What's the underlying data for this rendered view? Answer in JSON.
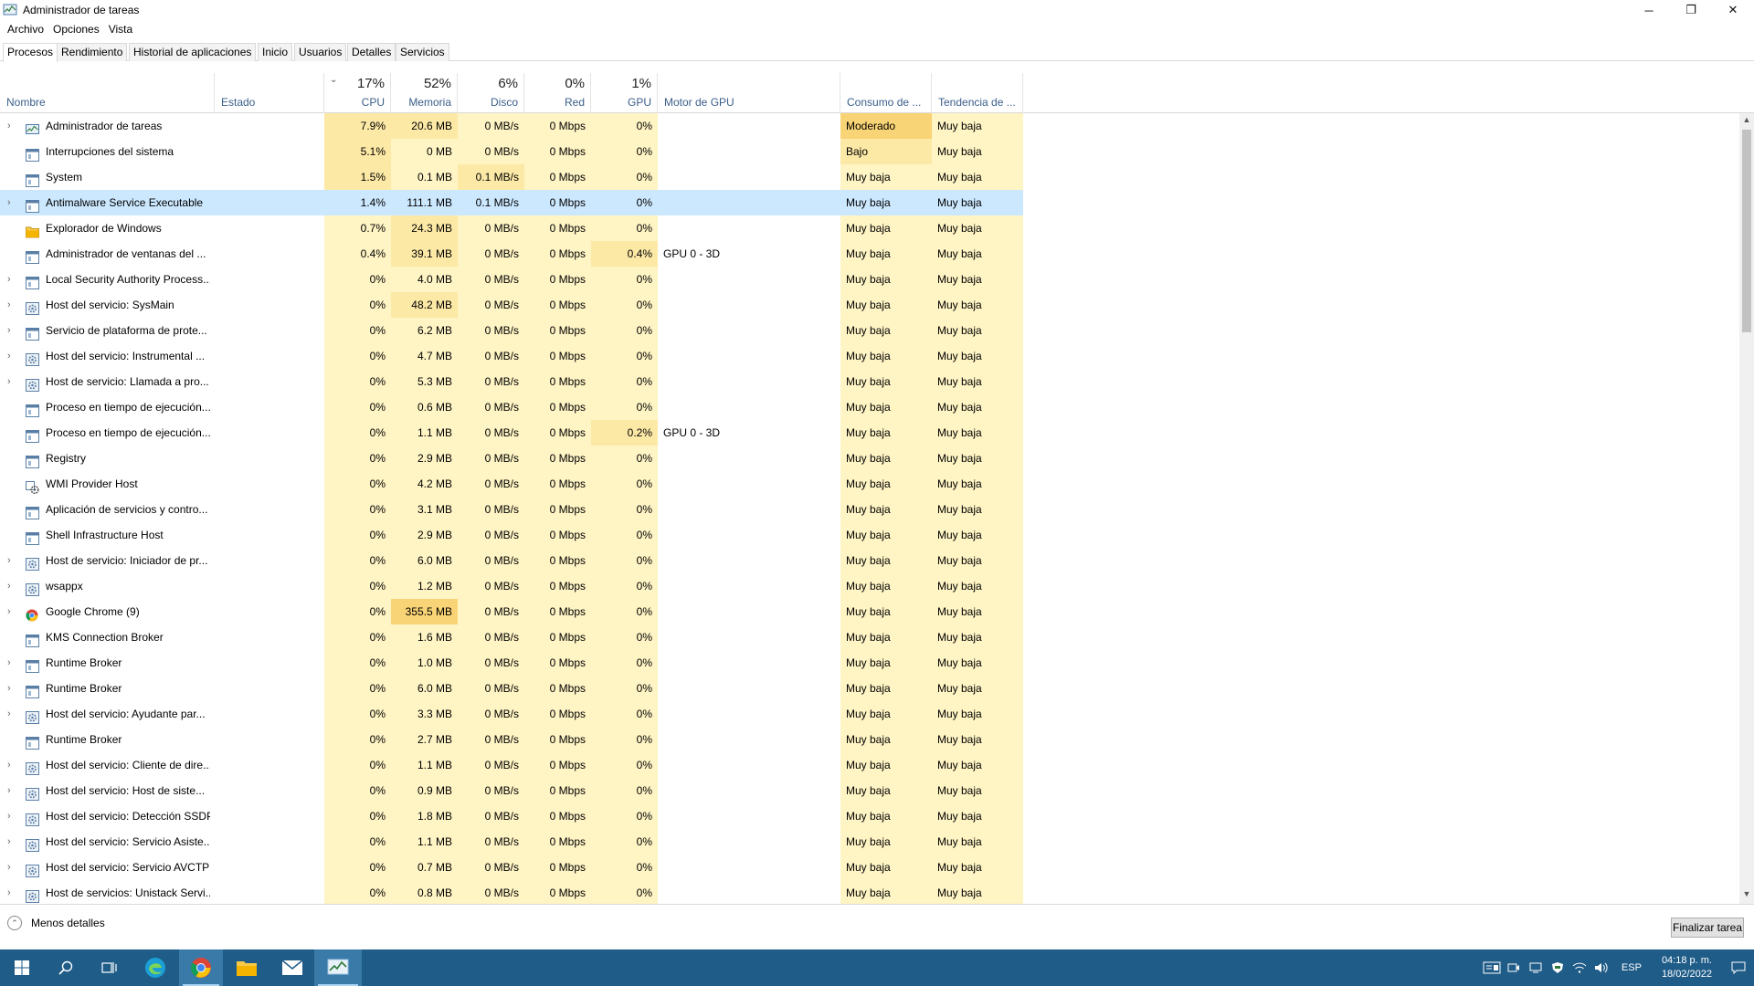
{
  "window": {
    "title": "Administrador de tareas",
    "controls": {
      "minimize": "─",
      "maximize": "❐",
      "close": "✕"
    }
  },
  "menu": [
    "Archivo",
    "Opciones",
    "Vista"
  ],
  "tabs": [
    "Procesos",
    "Rendimiento",
    "Historial de aplicaciones",
    "Inicio",
    "Usuarios",
    "Detalles",
    "Servicios"
  ],
  "active_tab": "Procesos",
  "header": {
    "name": "Nombre",
    "status": "Estado",
    "cpu_pct": "17%",
    "cpu": "CPU",
    "mem_pct": "52%",
    "mem": "Memoria",
    "disk_pct": "6%",
    "disk": "Disco",
    "net_pct": "0%",
    "net": "Red",
    "gpu_pct": "1%",
    "gpu": "GPU",
    "gpu_engine": "Motor de GPU",
    "power": "Consumo de ...",
    "power_trend": "Tendencia de ..."
  },
  "processes": [
    {
      "name": "Administrador de tareas",
      "expand": true,
      "icon": "taskmgr-icon",
      "cpu": "7.9%",
      "mem": "20.6 MB",
      "disk": "0 MB/s",
      "net": "0 Mbps",
      "gpu": "0%",
      "engine": "",
      "power": "Moderado",
      "trend": "Muy baja"
    },
    {
      "name": "Interrupciones del sistema",
      "expand": false,
      "icon": "window-icon",
      "cpu": "5.1%",
      "mem": "0 MB",
      "disk": "0 MB/s",
      "net": "0 Mbps",
      "gpu": "0%",
      "engine": "",
      "power": "Bajo",
      "trend": "Muy baja"
    },
    {
      "name": "System",
      "expand": false,
      "icon": "window-icon",
      "cpu": "1.5%",
      "mem": "0.1 MB",
      "disk": "0.1 MB/s",
      "net": "0 Mbps",
      "gpu": "0%",
      "engine": "",
      "power": "Muy baja",
      "trend": "Muy baja"
    },
    {
      "name": "Antimalware Service Executable",
      "expand": true,
      "icon": "window-icon",
      "cpu": "1.4%",
      "mem": "111.1 MB",
      "disk": "0.1 MB/s",
      "net": "0 Mbps",
      "gpu": "0%",
      "engine": "",
      "power": "Muy baja",
      "trend": "Muy baja",
      "selected": true
    },
    {
      "name": "Explorador de Windows",
      "expand": false,
      "icon": "folder-icon",
      "cpu": "0.7%",
      "mem": "24.3 MB",
      "disk": "0 MB/s",
      "net": "0 Mbps",
      "gpu": "0%",
      "engine": "",
      "power": "Muy baja",
      "trend": "Muy baja"
    },
    {
      "name": "Administrador de ventanas del ...",
      "expand": false,
      "icon": "window-icon",
      "cpu": "0.4%",
      "mem": "39.1 MB",
      "disk": "0 MB/s",
      "net": "0 Mbps",
      "gpu": "0.4%",
      "engine": "GPU 0 - 3D",
      "power": "Muy baja",
      "trend": "Muy baja"
    },
    {
      "name": "Local Security Authority Process...",
      "expand": true,
      "icon": "window-icon",
      "cpu": "0%",
      "mem": "4.0 MB",
      "disk": "0 MB/s",
      "net": "0 Mbps",
      "gpu": "0%",
      "engine": "",
      "power": "Muy baja",
      "trend": "Muy baja"
    },
    {
      "name": "Host del servicio: SysMain",
      "expand": true,
      "icon": "gear-icon",
      "cpu": "0%",
      "mem": "48.2 MB",
      "disk": "0 MB/s",
      "net": "0 Mbps",
      "gpu": "0%",
      "engine": "",
      "power": "Muy baja",
      "trend": "Muy baja"
    },
    {
      "name": "Servicio de plataforma de prote...",
      "expand": true,
      "icon": "window-icon",
      "cpu": "0%",
      "mem": "6.2 MB",
      "disk": "0 MB/s",
      "net": "0 Mbps",
      "gpu": "0%",
      "engine": "",
      "power": "Muy baja",
      "trend": "Muy baja"
    },
    {
      "name": "Host del servicio: Instrumental ...",
      "expand": true,
      "icon": "gear-icon",
      "cpu": "0%",
      "mem": "4.7 MB",
      "disk": "0 MB/s",
      "net": "0 Mbps",
      "gpu": "0%",
      "engine": "",
      "power": "Muy baja",
      "trend": "Muy baja"
    },
    {
      "name": "Host de servicio: Llamada a pro...",
      "expand": true,
      "icon": "gear-icon",
      "cpu": "0%",
      "mem": "5.3 MB",
      "disk": "0 MB/s",
      "net": "0 Mbps",
      "gpu": "0%",
      "engine": "",
      "power": "Muy baja",
      "trend": "Muy baja"
    },
    {
      "name": "Proceso en tiempo de ejecución...",
      "expand": false,
      "icon": "window-icon",
      "cpu": "0%",
      "mem": "0.6 MB",
      "disk": "0 MB/s",
      "net": "0 Mbps",
      "gpu": "0%",
      "engine": "",
      "power": "Muy baja",
      "trend": "Muy baja"
    },
    {
      "name": "Proceso en tiempo de ejecución...",
      "expand": false,
      "icon": "window-icon",
      "cpu": "0%",
      "mem": "1.1 MB",
      "disk": "0 MB/s",
      "net": "0 Mbps",
      "gpu": "0.2%",
      "engine": "GPU 0 - 3D",
      "power": "Muy baja",
      "trend": "Muy baja"
    },
    {
      "name": "Registry",
      "expand": false,
      "icon": "window-icon",
      "cpu": "0%",
      "mem": "2.9 MB",
      "disk": "0 MB/s",
      "net": "0 Mbps",
      "gpu": "0%",
      "engine": "",
      "power": "Muy baja",
      "trend": "Muy baja"
    },
    {
      "name": "WMI Provider Host",
      "expand": false,
      "icon": "wmi-icon",
      "cpu": "0%",
      "mem": "4.2 MB",
      "disk": "0 MB/s",
      "net": "0 Mbps",
      "gpu": "0%",
      "engine": "",
      "power": "Muy baja",
      "trend": "Muy baja"
    },
    {
      "name": "Aplicación de servicios y contro...",
      "expand": false,
      "icon": "window-icon",
      "cpu": "0%",
      "mem": "3.1 MB",
      "disk": "0 MB/s",
      "net": "0 Mbps",
      "gpu": "0%",
      "engine": "",
      "power": "Muy baja",
      "trend": "Muy baja"
    },
    {
      "name": "Shell Infrastructure Host",
      "expand": false,
      "icon": "window-icon",
      "cpu": "0%",
      "mem": "2.9 MB",
      "disk": "0 MB/s",
      "net": "0 Mbps",
      "gpu": "0%",
      "engine": "",
      "power": "Muy baja",
      "trend": "Muy baja"
    },
    {
      "name": "Host de servicio: Iniciador de pr...",
      "expand": true,
      "icon": "gear-icon",
      "cpu": "0%",
      "mem": "6.0 MB",
      "disk": "0 MB/s",
      "net": "0 Mbps",
      "gpu": "0%",
      "engine": "",
      "power": "Muy baja",
      "trend": "Muy baja"
    },
    {
      "name": "wsappx",
      "expand": true,
      "icon": "gear-icon",
      "cpu": "0%",
      "mem": "1.2 MB",
      "disk": "0 MB/s",
      "net": "0 Mbps",
      "gpu": "0%",
      "engine": "",
      "power": "Muy baja",
      "trend": "Muy baja"
    },
    {
      "name": "Google Chrome (9)",
      "expand": true,
      "icon": "chrome-icon",
      "cpu": "0%",
      "mem": "355.5 MB",
      "disk": "0 MB/s",
      "net": "0 Mbps",
      "gpu": "0%",
      "engine": "",
      "power": "Muy baja",
      "trend": "Muy baja",
      "mem_hot": true
    },
    {
      "name": "KMS Connection Broker",
      "expand": false,
      "icon": "window-icon",
      "cpu": "0%",
      "mem": "1.6 MB",
      "disk": "0 MB/s",
      "net": "0 Mbps",
      "gpu": "0%",
      "engine": "",
      "power": "Muy baja",
      "trend": "Muy baja"
    },
    {
      "name": "Runtime Broker",
      "expand": true,
      "icon": "window-icon",
      "cpu": "0%",
      "mem": "1.0 MB",
      "disk": "0 MB/s",
      "net": "0 Mbps",
      "gpu": "0%",
      "engine": "",
      "power": "Muy baja",
      "trend": "Muy baja"
    },
    {
      "name": "Runtime Broker",
      "expand": true,
      "icon": "window-icon",
      "cpu": "0%",
      "mem": "6.0 MB",
      "disk": "0 MB/s",
      "net": "0 Mbps",
      "gpu": "0%",
      "engine": "",
      "power": "Muy baja",
      "trend": "Muy baja"
    },
    {
      "name": "Host del servicio: Ayudante par...",
      "expand": true,
      "icon": "gear-icon",
      "cpu": "0%",
      "mem": "3.3 MB",
      "disk": "0 MB/s",
      "net": "0 Mbps",
      "gpu": "0%",
      "engine": "",
      "power": "Muy baja",
      "trend": "Muy baja"
    },
    {
      "name": "Runtime Broker",
      "expand": false,
      "icon": "window-icon",
      "cpu": "0%",
      "mem": "2.7 MB",
      "disk": "0 MB/s",
      "net": "0 Mbps",
      "gpu": "0%",
      "engine": "",
      "power": "Muy baja",
      "trend": "Muy baja"
    },
    {
      "name": "Host del servicio: Cliente de dire...",
      "expand": true,
      "icon": "gear-icon",
      "cpu": "0%",
      "mem": "1.1 MB",
      "disk": "0 MB/s",
      "net": "0 Mbps",
      "gpu": "0%",
      "engine": "",
      "power": "Muy baja",
      "trend": "Muy baja"
    },
    {
      "name": "Host del servicio: Host de siste...",
      "expand": true,
      "icon": "gear-icon",
      "cpu": "0%",
      "mem": "0.9 MB",
      "disk": "0 MB/s",
      "net": "0 Mbps",
      "gpu": "0%",
      "engine": "",
      "power": "Muy baja",
      "trend": "Muy baja"
    },
    {
      "name": "Host del servicio: Detección SSDP",
      "expand": true,
      "icon": "gear-icon",
      "cpu": "0%",
      "mem": "1.8 MB",
      "disk": "0 MB/s",
      "net": "0 Mbps",
      "gpu": "0%",
      "engine": "",
      "power": "Muy baja",
      "trend": "Muy baja"
    },
    {
      "name": "Host del servicio: Servicio Asiste...",
      "expand": true,
      "icon": "gear-icon",
      "cpu": "0%",
      "mem": "1.1 MB",
      "disk": "0 MB/s",
      "net": "0 Mbps",
      "gpu": "0%",
      "engine": "",
      "power": "Muy baja",
      "trend": "Muy baja"
    },
    {
      "name": "Host del servicio: Servicio AVCTP",
      "expand": true,
      "icon": "gear-icon",
      "cpu": "0%",
      "mem": "0.7 MB",
      "disk": "0 MB/s",
      "net": "0 Mbps",
      "gpu": "0%",
      "engine": "",
      "power": "Muy baja",
      "trend": "Muy baja"
    },
    {
      "name": "Host de servicios: Unistack Servi...",
      "expand": true,
      "icon": "gear-icon",
      "cpu": "0%",
      "mem": "0.8 MB",
      "disk": "0 MB/s",
      "net": "0 Mbps",
      "gpu": "0%",
      "engine": "",
      "power": "Muy baja",
      "trend": "Muy baja"
    }
  ],
  "footer": {
    "less_details": "Menos detalles",
    "end_task": "Finalizar tarea"
  },
  "taskbar": {
    "apps": [
      "windows-start-icon",
      "search-icon",
      "task-view-icon",
      "edge-icon",
      "chrome-icon",
      "file-explorer-icon",
      "mail-icon",
      "task-manager-icon"
    ],
    "language": "ESP",
    "time": "04:18 p. m.",
    "date": "18/02/2022"
  },
  "colors": {
    "heat_low": "#fff4c4",
    "heat_mid": "#fde9a6",
    "heat_high": "#f9d476",
    "selected": "#cce8ff",
    "taskbar": "#1f5c88"
  }
}
